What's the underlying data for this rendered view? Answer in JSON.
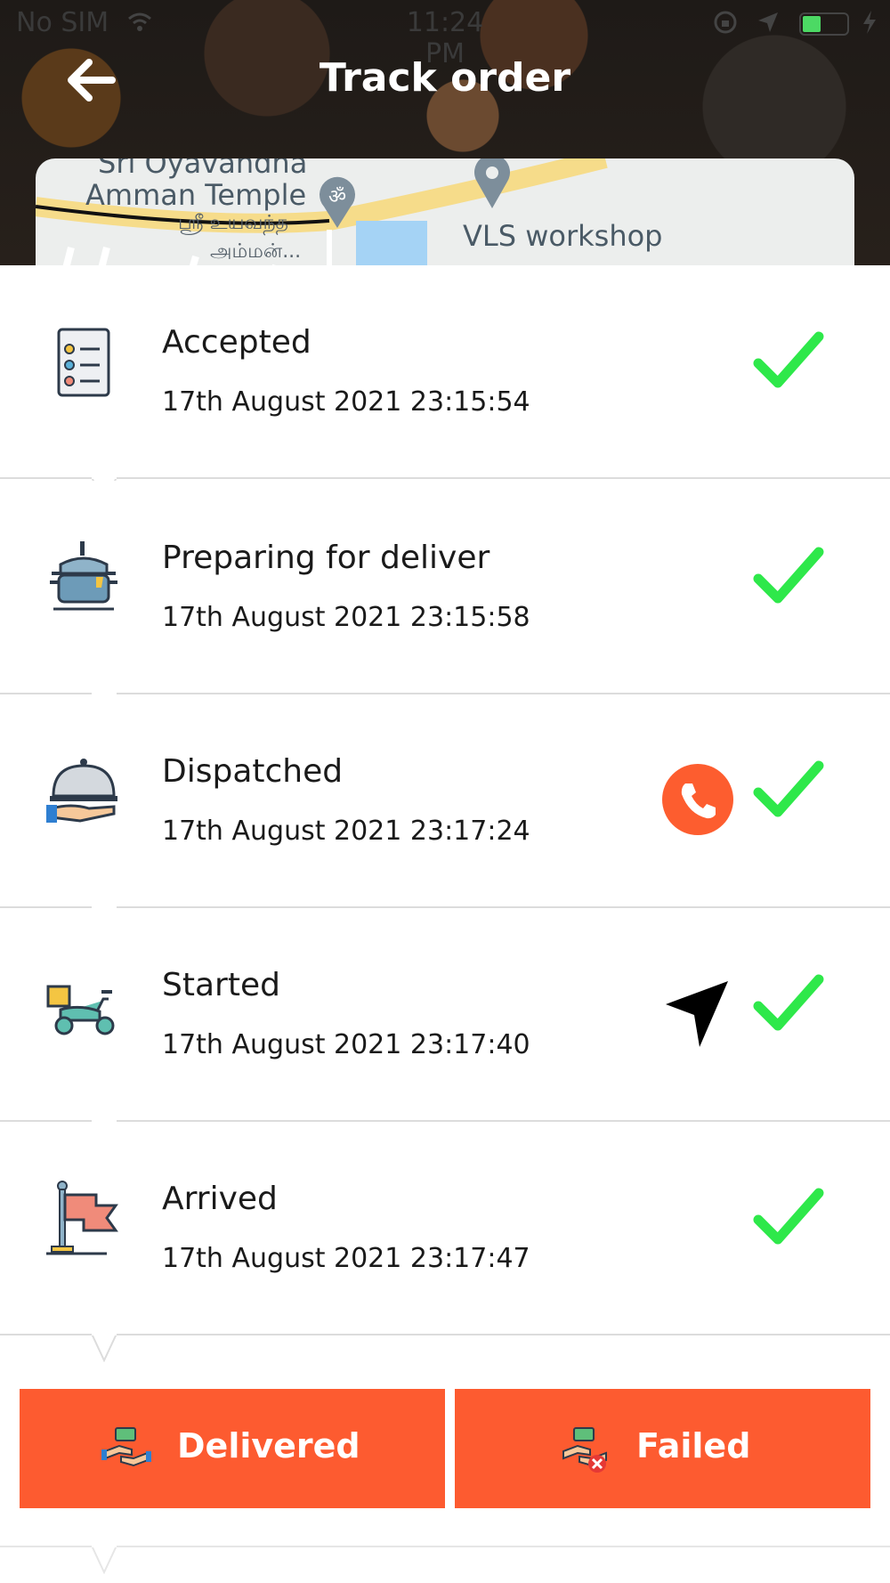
{
  "status_bar": {
    "carrier": "No SIM",
    "time": "11:24 PM"
  },
  "header": {
    "title": "Track order",
    "back_icon": "arrow-left-icon"
  },
  "map": {
    "temple_label_line1": "Sri Oyavandha",
    "temple_label_line2": "Amman Temple",
    "tamil_label_line1": "ஸ்ரீ உயவந்த",
    "tamil_label_line2": "அம்மன்...",
    "place_label": "VLS workshop"
  },
  "steps": [
    {
      "title": "Accepted",
      "time": "17th August 2021 23:15:54",
      "icon": "checklist-icon",
      "done": true
    },
    {
      "title": "Preparing for deliver",
      "time": "17th August 2021 23:15:58",
      "icon": "cooking-pot-icon",
      "done": true
    },
    {
      "title": "Dispatched",
      "time": "17th August 2021 23:17:24",
      "icon": "serving-cloche-icon",
      "done": true,
      "action": "call-icon"
    },
    {
      "title": "Started",
      "time": "17th August 2021 23:17:40",
      "icon": "delivery-scooter-icon",
      "done": true,
      "action": "navigation-arrow-icon"
    },
    {
      "title": "Arrived",
      "time": "17th August 2021 23:17:47",
      "icon": "flag-icon",
      "done": true
    }
  ],
  "actions": {
    "delivered_label": "Delivered",
    "failed_label": "Failed"
  },
  "colors": {
    "accent": "#fd5b30",
    "check": "#2ee84a"
  }
}
